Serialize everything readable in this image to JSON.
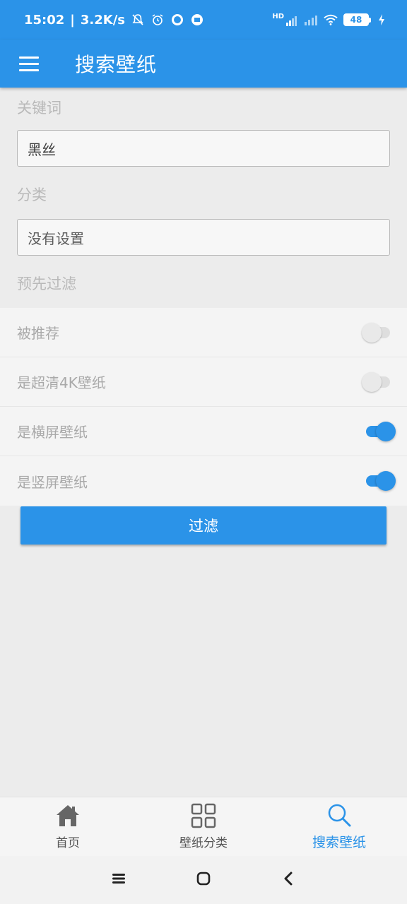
{
  "status_bar": {
    "time": "15:02",
    "net_speed": "3.2K/s",
    "battery": "48",
    "network_label": "HD",
    "icons": [
      "mute-bell-icon",
      "alarm-icon",
      "app-icon",
      "message-icon",
      "signal-icon",
      "signal-icon",
      "wifi-icon",
      "battery-icon",
      "charging-icon"
    ]
  },
  "app_bar": {
    "title": "搜索壁纸",
    "menu_icon": "menu-icon"
  },
  "form": {
    "keyword_label": "关键词",
    "keyword_value": "黑丝",
    "category_label": "分类",
    "category_value": "没有设置",
    "prefilter_label": "预先过滤",
    "toggles": [
      {
        "label": "被推荐",
        "on": false
      },
      {
        "label": "是超清4K壁纸",
        "on": false
      },
      {
        "label": "是横屏壁纸",
        "on": true
      },
      {
        "label": "是竖屏壁纸",
        "on": true
      }
    ],
    "filter_button": "过滤"
  },
  "bottom_nav": {
    "items": [
      {
        "label": "首页",
        "icon": "home-icon",
        "active": false
      },
      {
        "label": "壁纸分类",
        "icon": "grid-icon",
        "active": false
      },
      {
        "label": "搜索壁纸",
        "icon": "search-icon",
        "active": true
      }
    ]
  },
  "system_nav": {
    "icons": [
      "recents-icon",
      "home-button-icon",
      "back-icon"
    ]
  },
  "colors": {
    "primary": "#2b93e8",
    "background": "#ececec"
  }
}
